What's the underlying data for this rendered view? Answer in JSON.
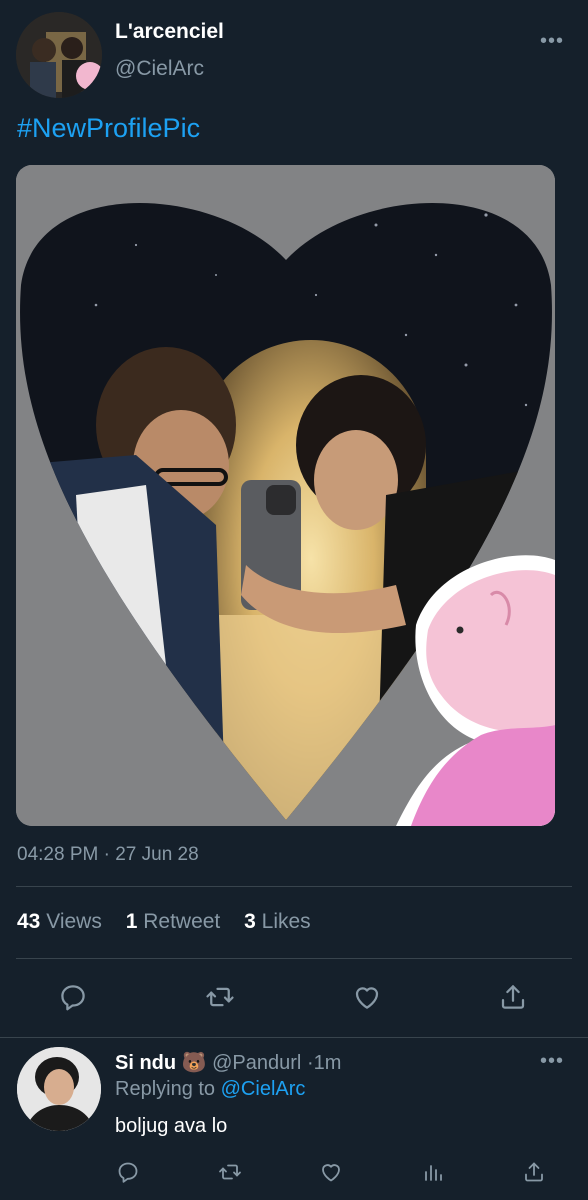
{
  "tweet": {
    "author_name": "L'arcenciel",
    "author_handle": "@CielArc",
    "text": "#NewProfilePic",
    "timestamp": "04:28 PM · 27 Jun 28",
    "more_label": "•••"
  },
  "stats": {
    "views_count": "43",
    "views_label": "Views",
    "retweets_count": "1",
    "retweets_label": "Retweet",
    "likes_count": "3",
    "likes_label": "Likes"
  },
  "actions": [
    "reply-icon",
    "retweet-icon",
    "like-icon",
    "share-icon"
  ],
  "reply": {
    "author_name": "Si ndu 🐻",
    "author_handle": "@Pandurl",
    "time_sep": "·",
    "time": "1m",
    "replying_prefix": "Replying to",
    "replying_to": "@CielArc",
    "text": "boljug ava lo",
    "more_label": "•••",
    "actions": [
      "reply-icon",
      "retweet-icon",
      "like-icon",
      "views-icon",
      "share-icon"
    ]
  },
  "colors": {
    "background": "#15202b",
    "accent": "#1da1f2",
    "secondary_text": "#8899a6",
    "divider": "#38444d"
  }
}
